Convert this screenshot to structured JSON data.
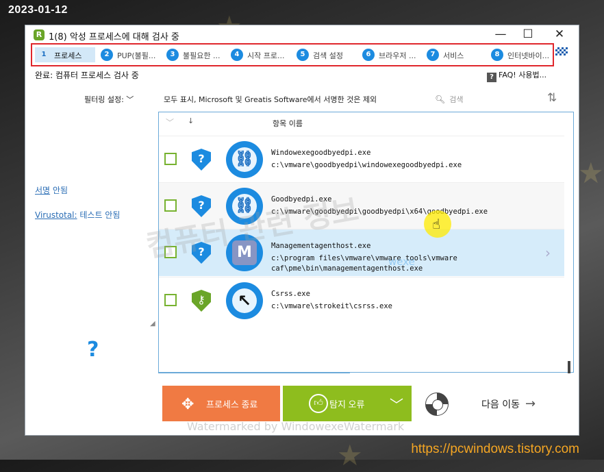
{
  "overlay": {
    "date": "2023-01-12",
    "site_url": "https://pcwindows.tistory.com"
  },
  "window": {
    "title": "1(8) 악성 프로세스에 대해 검사 중",
    "controls": {
      "minimize": "—",
      "maximize": "☐",
      "close": "✕"
    }
  },
  "steps": [
    {
      "num": "1",
      "label": "프로세스"
    },
    {
      "num": "2",
      "label": "PUP(불필..."
    },
    {
      "num": "3",
      "label": "불필요한 ..."
    },
    {
      "num": "4",
      "label": "시작 프로..."
    },
    {
      "num": "5",
      "label": "검색 설정"
    },
    {
      "num": "6",
      "label": "브라우저 ..."
    },
    {
      "num": "7",
      "label": "서비스"
    },
    {
      "num": "8",
      "label": "인터넷바이..."
    }
  ],
  "status": {
    "text": "완료: 컴퓨터 프로세스 검사 중",
    "faq_icon": "?",
    "faq": "FAQ! 사용법..."
  },
  "filter": {
    "label": "필터링 설정: ﹀",
    "description": "모두 표시, Microsoft 및 Greatis Software에서 서명한 것은 제외",
    "search_placeholder": "검색"
  },
  "sidebar": {
    "signature_link": "서명",
    "signature_suffix": " 안됨",
    "virustotal_link": "Virustotal:",
    "virustotal_suffix": " 테스트 안됨",
    "help": "?"
  },
  "list": {
    "header_name": "항목 이름",
    "rows": [
      {
        "name": "Windowexegoodbyedpi.exe",
        "path": "c:\\vmware\\goodbyedpi\\windowexegoodbyedpi.exe",
        "shield": "?",
        "shield_color": "#1c8be0",
        "icon": "⛓"
      },
      {
        "name": "Goodbyedpi.exe",
        "path": "c:\\vmware\\goodbyedpi\\goodbyedpi\\x64\\goodbyedpi.exe",
        "shield": "?",
        "shield_color": "#1c8be0",
        "icon": "⛓"
      },
      {
        "name": "Managementagenthost.exe",
        "path": "c:\\program files\\vmware\\vmware tools\\vmware caf\\pme\\bin\\managementagenthost.exe",
        "shield": "?",
        "shield_color": "#1c8be0",
        "icon": "M"
      },
      {
        "name": "Csrss.exe",
        "path": "c:\\vmware\\strokeit\\csrss.exe",
        "shield": "⚷",
        "shield_color": "#6aa528",
        "icon": "↖"
      }
    ]
  },
  "buttons": {
    "kill": "프로세스 종료",
    "wrong": "탐지 오류",
    "next": "다음 이동"
  },
  "watermarks": {
    "center": "컴퓨터 관련 정보",
    "bottom": "Watermarked by WindowexeWatermark",
    "mid": "wexe"
  },
  "colors": {
    "accent_blue": "#1c8be0",
    "kill_orange": "#f07a43",
    "wrong_green": "#8ebd1e",
    "highlight_red": "#e0262b"
  }
}
